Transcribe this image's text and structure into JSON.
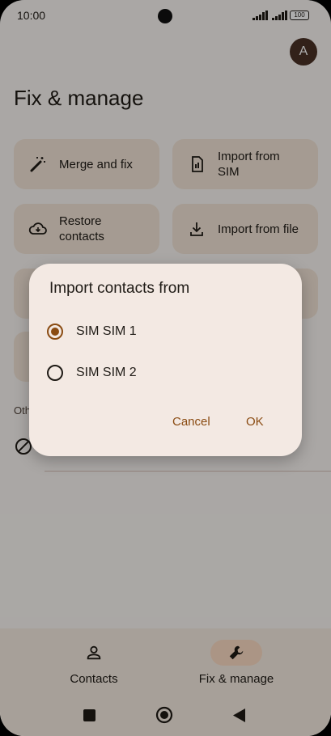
{
  "status_bar": {
    "time": "10:00",
    "battery": "100"
  },
  "header": {
    "avatar_initial": "A",
    "title": "Fix & manage"
  },
  "tiles": [
    {
      "label": "Merge and fix",
      "icon": "magic-wand-icon"
    },
    {
      "label": "Import from SIM",
      "icon": "sim-card-icon"
    },
    {
      "label": "Restore contacts",
      "icon": "cloud-restore-icon"
    },
    {
      "label": "Import from file",
      "icon": "download-icon"
    }
  ],
  "other_section": {
    "label": "Oth",
    "icon": "block-icon"
  },
  "dialog": {
    "title": "Import contacts from",
    "options": [
      {
        "label": "SIM SIM 1",
        "selected": true
      },
      {
        "label": "SIM SIM 2",
        "selected": false
      }
    ],
    "cancel_label": "Cancel",
    "ok_label": "OK"
  },
  "bottom_nav": [
    {
      "label": "Contacts",
      "icon": "person-icon",
      "active": false
    },
    {
      "label": "Fix & manage",
      "icon": "wrench-icon",
      "active": true
    }
  ],
  "system_nav": {
    "icons": [
      "recents-square-icon",
      "home-circle-icon",
      "back-triangle-icon"
    ]
  },
  "colors": {
    "accent": "#8a4b12",
    "tile_bg": "#f3e5d8",
    "dialog_bg": "#f3e9e3",
    "nav_active": "#fddcc4"
  }
}
